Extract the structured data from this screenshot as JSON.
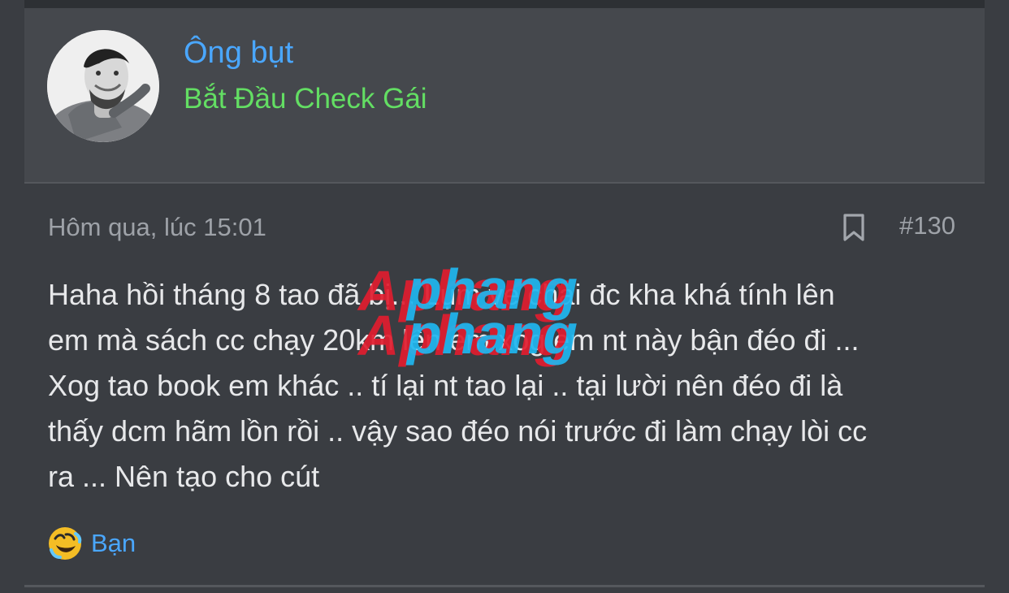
{
  "author": {
    "username": "Ông bụt",
    "user_title": "Bắt Đầu Check Gái",
    "avatar_icon": "user-avatar-photo"
  },
  "post": {
    "date": "Hôm qua, lúc 15:01",
    "post_number": "#130",
    "bookmark_icon": "bookmark-icon",
    "message": "Haha hồi tháng 8 tao đã bị... Lụm ve chai đc kha khá tính lên\nem mà sách cc chạy 20km lên em xog em nt này bận đéo đi ...\nXog tao book em khác .. tí lại nt tao lại .. tại lười nên đéo đi là\nthấy dcm hãm lồn rồi .. vậy sao đéo nói trước đi làm chạy lòi cc\nra ... Nên tạo cho cút"
  },
  "reaction": {
    "icon": "laughing-emoji-icon",
    "label": "Bạn"
  },
  "watermark": {
    "line1": "Aphang",
    "line2": "Aphang"
  },
  "colors": {
    "background": "#3a3d42",
    "author_panel": "#45484d",
    "username": "#4aa7ff",
    "user_title": "#63de63",
    "meta_text": "#9ea2a8",
    "message_text": "#e7e8ea",
    "watermark_red": "#e11d2f",
    "watermark_cyan": "#1fb7f0"
  }
}
